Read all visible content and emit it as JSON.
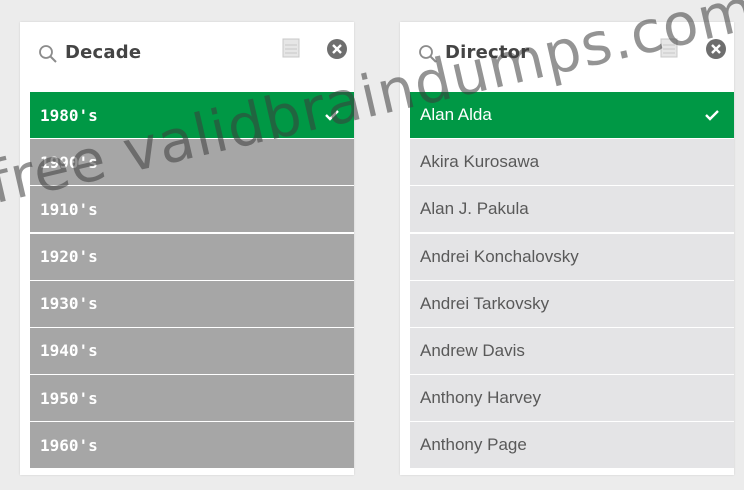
{
  "decade_panel": {
    "title": "Decade",
    "items": [
      {
        "label": "1980's",
        "selected": true
      },
      {
        "label": "1990's",
        "selected": false
      },
      {
        "label": "1910's",
        "selected": false
      },
      {
        "label": "1920's",
        "selected": false
      },
      {
        "label": "1930's",
        "selected": false
      },
      {
        "label": "1940's",
        "selected": false
      },
      {
        "label": "1950's",
        "selected": false
      },
      {
        "label": "1960's",
        "selected": false
      }
    ]
  },
  "director_panel": {
    "title": "Director",
    "items": [
      {
        "label": "Alan Alda",
        "selected": true
      },
      {
        "label": "Akira Kurosawa",
        "selected": false
      },
      {
        "label": "Alan J. Pakula",
        "selected": false
      },
      {
        "label": "Andrei Konchalovsky",
        "selected": false
      },
      {
        "label": "Andrei Tarkovsky",
        "selected": false
      },
      {
        "label": "Andrew Davis",
        "selected": false
      },
      {
        "label": "Anthony Harvey",
        "selected": false
      },
      {
        "label": "Anthony Page",
        "selected": false
      }
    ]
  },
  "watermark": "free validbraindumps.com",
  "icons": {
    "search": "search-icon",
    "menu": "menu-icon",
    "clear": "clear-selection-icon",
    "check": "check-icon"
  },
  "colors": {
    "selected": "#009845",
    "decade_row": "#a6a6a6",
    "director_row": "#e4e4e6",
    "background": "#ececec"
  }
}
